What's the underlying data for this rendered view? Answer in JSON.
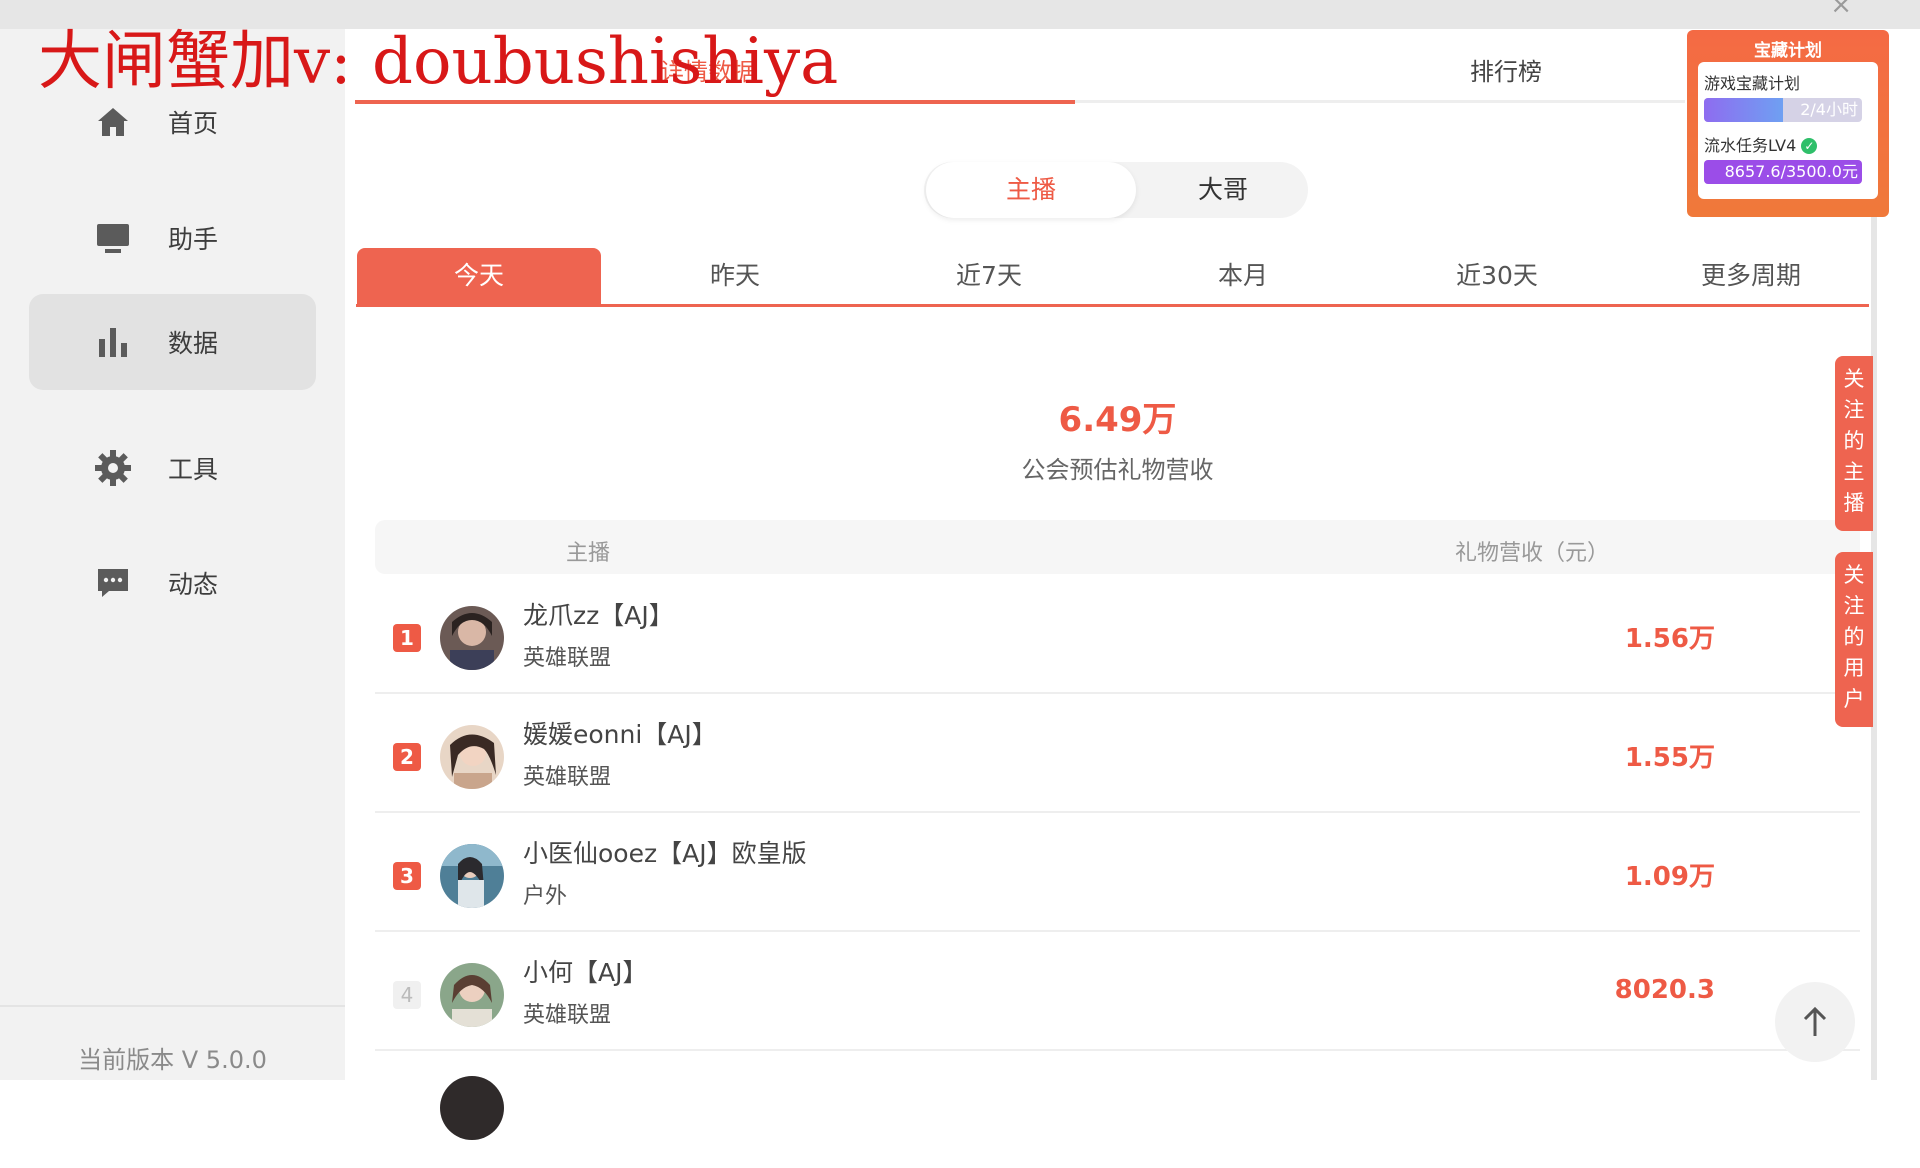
{
  "window": {
    "close_glyph": "×"
  },
  "watermark": "大闸蟹加v: doubushishiya",
  "sidebar": {
    "items": [
      {
        "label": "首页",
        "icon": "home-icon"
      },
      {
        "label": "助手",
        "icon": "monitor-icon"
      },
      {
        "label": "数据",
        "icon": "bar-chart-icon",
        "active": true
      },
      {
        "label": "工具",
        "icon": "gear-icon"
      },
      {
        "label": "动态",
        "icon": "message-icon"
      }
    ],
    "version": "当前版本 V 5.0.0"
  },
  "top_tabs": [
    {
      "label": "详情数据",
      "active": true
    },
    {
      "label": "排行榜",
      "active": false
    }
  ],
  "segment": {
    "left": "主播",
    "right": "大哥",
    "active": "主播"
  },
  "periods": [
    "今天",
    "昨天",
    "近7天",
    "本月",
    "近30天",
    "更多周期"
  ],
  "active_period": "今天",
  "summary": {
    "value": "6.49万",
    "label": "公会预估礼物营收"
  },
  "table": {
    "col_streamer": "主播",
    "col_amount": "礼物营收（元）",
    "rows": [
      {
        "rank": "1",
        "name": "龙爪zz【AJ】",
        "category": "英雄联盟",
        "amount": "1.56万"
      },
      {
        "rank": "2",
        "name": "媛媛eonni【AJ】",
        "category": "英雄联盟",
        "amount": "1.55万"
      },
      {
        "rank": "3",
        "name": "小医仙ooez【AJ】欧皇版",
        "category": "户外",
        "amount": "1.09万"
      },
      {
        "rank": "4",
        "name": "小何【AJ】",
        "category": "英雄联盟",
        "amount": "8020.3"
      }
    ]
  },
  "promo": {
    "title": "宝藏计划",
    "item1": "游戏宝藏计划",
    "bar1": {
      "text": "2/4小时",
      "progress": 0.5
    },
    "item2": "流水任务LV4",
    "bar2": {
      "text": "8657.6/3500.0元",
      "progress": 1.0
    }
  },
  "side_buttons": {
    "follow_streamer": [
      "关",
      "注",
      "的",
      "主",
      "播"
    ],
    "follow_user": [
      "关",
      "注",
      "的",
      "用",
      "户"
    ]
  },
  "back_to_top_icon": "arrow-up-icon",
  "colors": {
    "accent": "#ee6450",
    "accent_text": "#ee5a45",
    "promo_purple": "#9b4de8"
  }
}
